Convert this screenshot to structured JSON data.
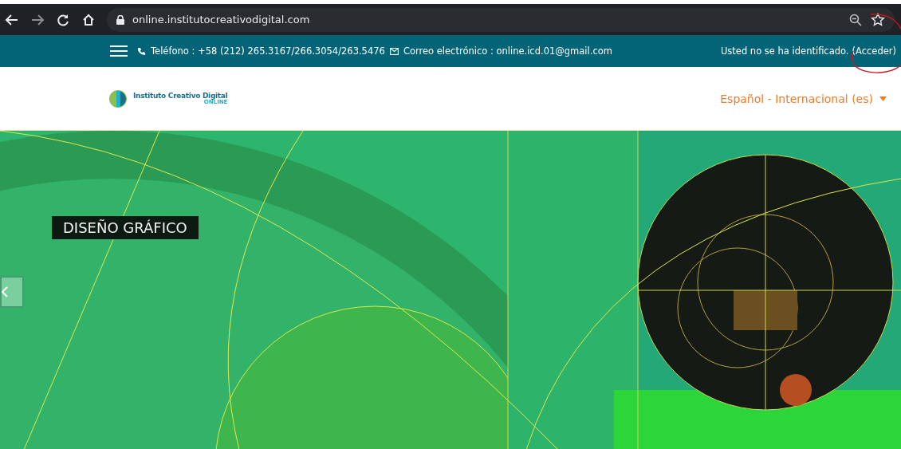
{
  "browser": {
    "url": "online.institutocreativodigital.com"
  },
  "top_bar": {
    "phone": "Teléfono : +58 (212) 265.3167/266.3054/263.5476",
    "email": "Correo electrónico : online.icd.01@gmail.com",
    "login_status": "Usted no se ha identificado.",
    "login_link": "(Acceder)"
  },
  "header": {
    "logo_name": "Instituto Creativo Digital",
    "logo_tagline": "ONLINE",
    "language": "Español - Internacional (es)"
  },
  "slider": {
    "caption": "DISEÑO GRÁFICO"
  }
}
